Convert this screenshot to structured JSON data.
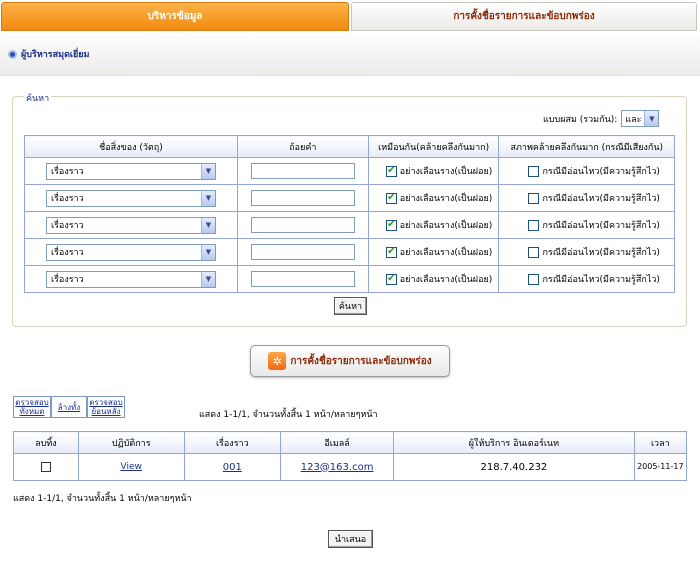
{
  "tabs": {
    "active": "บริหารข้อมูล",
    "inactive": "การคั้งชื่อรายการและข้อบกพร่อง"
  },
  "crumb": "ผู้บริหารสมุดเยี่ยม",
  "search": {
    "legend": "ค้นหา",
    "mode_label": "แบบผสม (รวมกัน):",
    "mode_value": "และ",
    "headers": [
      "ชื่อสิ่งของ (วัตถุ)",
      "ถ้อยคำ",
      "เหมือนกัน(คล้ายคลึงกันมาก)",
      "สภาพคล้ายคลึงกันมาก (กรณีมีเสียงกัน)"
    ],
    "rows": [
      {
        "field": "เรื่องราว",
        "keyword": "",
        "exact_checked": true,
        "exact_label": "อย่างเลือนราง(เป็นฝอย)",
        "fuzzy_checked": false,
        "fuzzy_label": "กรณีมีอ่อนไหว(มีความรู้สึกไว)"
      },
      {
        "field": "เรื่องราว",
        "keyword": "",
        "exact_checked": true,
        "exact_label": "อย่างเลือนราง(เป็นฝอย)",
        "fuzzy_checked": false,
        "fuzzy_label": "กรณีมีอ่อนไหว(มีความรู้สึกไว)"
      },
      {
        "field": "เรื่องราว",
        "keyword": "",
        "exact_checked": true,
        "exact_label": "อย่างเลือนราง(เป็นฝอย)",
        "fuzzy_checked": false,
        "fuzzy_label": "กรณีมีอ่อนไหว(มีความรู้สึกไว)"
      },
      {
        "field": "เรื่องราว",
        "keyword": "",
        "exact_checked": true,
        "exact_label": "อย่างเลือนราง(เป็นฝอย)",
        "fuzzy_checked": false,
        "fuzzy_label": "กรณีมีอ่อนไหว(มีความรู้สึกไว)"
      },
      {
        "field": "เรื่องราว",
        "keyword": "",
        "exact_checked": true,
        "exact_label": "อย่างเลือนราง(เป็นฝอย)",
        "fuzzy_checked": false,
        "fuzzy_label": "กรณีมีอ่อนไหว(มีความรู้สึกไว)"
      }
    ],
    "button": "ค้นหา"
  },
  "big_button": "การคั้งชื่อรายการและข้อบกพร่อง",
  "actions": {
    "check_all": "ตรวจสอบทั้งหมด",
    "clear": "ล้างทั้ง",
    "reverse": "ตรวจสอบย้อนหลัง"
  },
  "pager": "แสดง 1-1/1, จำนวนทั้งสิ้น 1 หน้า/หลายๆหน้า",
  "results": {
    "headers": [
      "ลบทิ้ง",
      "ปฏิบัติการ",
      "เรื่องราว",
      "อีเมลล์",
      "ผู้ให้บริการ อินเตอร์เนท",
      "เวลา"
    ],
    "rows": [
      {
        "checked": false,
        "action": "View",
        "subject": "001",
        "email": "123@163.com",
        "isp": "218.7.40.232",
        "time": "2005-11-17"
      }
    ]
  },
  "submit": "นำเสนอ",
  "colors": {
    "tab_active": "#f18a0f",
    "tab_inactive_text": "#8a2a0a",
    "link": "#1c2f8a",
    "grid_border": "#94a7d4"
  }
}
